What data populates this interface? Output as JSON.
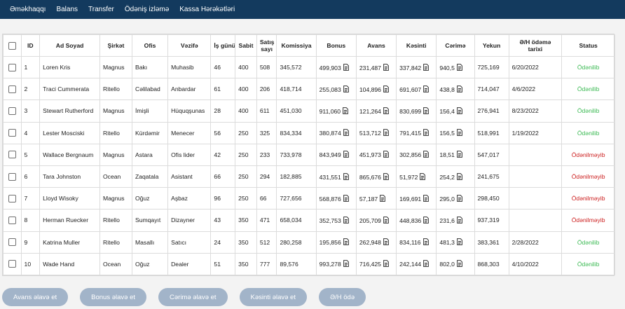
{
  "nav": {
    "items": [
      "Əməkhaqqı",
      "Balans",
      "Transfer",
      "Ödəniş izləmə",
      "Kassa Hərəkətləri"
    ]
  },
  "table": {
    "headers": {
      "id": "ID",
      "name": "Ad Soyad",
      "company": "Şirkət",
      "office": "Ofis",
      "position": "Vəzifə",
      "workdays": "İş günü",
      "base": "Sabit",
      "sales": "Satış sayı",
      "commission": "Komissiya",
      "bonus": "Bonus",
      "advance": "Avans",
      "deduction": "Kəsinti",
      "fine": "Cərimə",
      "total": "Yekun",
      "pay_date": "Ə/H ödəmə tarixi",
      "status": "Status"
    },
    "rows": [
      {
        "id": "1",
        "name": "Loren Kris",
        "company": "Magnus",
        "office": "Bakı",
        "position": "Muhasib",
        "workdays": "46",
        "base": "400",
        "sales": "508",
        "commission": "345,572",
        "bonus": "499,903",
        "advance": "231,487",
        "deduction": "337,842",
        "fine": "940,5",
        "total": "725,169",
        "pay_date": "6/20/2022",
        "status": "Ödənilib",
        "paid": true
      },
      {
        "id": "2",
        "name": "Traci Cummerata",
        "company": "Ritello",
        "office": "Cəlilabad",
        "position": "Anbardar",
        "workdays": "61",
        "base": "400",
        "sales": "206",
        "commission": "418,714",
        "bonus": "255,083",
        "advance": "104,896",
        "deduction": "691,607",
        "fine": "438,8",
        "total": "714,047",
        "pay_date": "4/6/2022",
        "status": "Ödənilib",
        "paid": true
      },
      {
        "id": "3",
        "name": "Stewart Rutherford",
        "company": "Magnus",
        "office": "İmişli",
        "position": "Hüquqşunas",
        "workdays": "28",
        "base": "400",
        "sales": "611",
        "commission": "451,030",
        "bonus": "911,060",
        "advance": "121,264",
        "deduction": "830,699",
        "fine": "156,4",
        "total": "276,941",
        "pay_date": "8/23/2022",
        "status": "Ödənilib",
        "paid": true
      },
      {
        "id": "4",
        "name": "Lester Mosciski",
        "company": "Ritello",
        "office": "Kürdəmir",
        "position": "Menecer",
        "workdays": "56",
        "base": "250",
        "sales": "325",
        "commission": "834,334",
        "bonus": "380,874",
        "advance": "513,712",
        "deduction": "791,415",
        "fine": "156,5",
        "total": "518,991",
        "pay_date": "1/19/2022",
        "status": "Ödənilib",
        "paid": true
      },
      {
        "id": "5",
        "name": "Wallace Bergnaum",
        "company": "Magnus",
        "office": "Astara",
        "position": "Ofis lider",
        "workdays": "42",
        "base": "250",
        "sales": "233",
        "commission": "733,978",
        "bonus": "843,949",
        "advance": "451,973",
        "deduction": "302,856",
        "fine": "18,51",
        "total": "547,017",
        "pay_date": "",
        "status": "Ödənilməyib",
        "paid": false
      },
      {
        "id": "6",
        "name": "Tara Johnston",
        "company": "Ocean",
        "office": "Zaqatala",
        "position": "Asistant",
        "workdays": "66",
        "base": "250",
        "sales": "294",
        "commission": "182,885",
        "bonus": "431,551",
        "advance": "865,676",
        "deduction": "51,972",
        "fine": "254,2",
        "total": "241,675",
        "pay_date": "",
        "status": "Ödənilməyib",
        "paid": false
      },
      {
        "id": "7",
        "name": "Lloyd Wisoky",
        "company": "Magnus",
        "office": "Oğuz",
        "position": "Aşbaz",
        "workdays": "96",
        "base": "250",
        "sales": "66",
        "commission": "727,656",
        "bonus": "568,876",
        "advance": "57,187",
        "deduction": "169,691",
        "fine": "295,0",
        "total": "298,450",
        "pay_date": "",
        "status": "Ödənilməyib",
        "paid": false
      },
      {
        "id": "8",
        "name": "Herman Ruecker",
        "company": "Ritello",
        "office": "Sumqayıt",
        "position": "Dizayner",
        "workdays": "43",
        "base": "350",
        "sales": "471",
        "commission": "658,034",
        "bonus": "352,753",
        "advance": "205,709",
        "deduction": "448,836",
        "fine": "231,6",
        "total": "937,319",
        "pay_date": "",
        "status": "Ödənilməyib",
        "paid": false
      },
      {
        "id": "9",
        "name": "Katrina Muller",
        "company": "Ritello",
        "office": "Masallı",
        "position": "Satıcı",
        "workdays": "24",
        "base": "350",
        "sales": "512",
        "commission": "280,258",
        "bonus": "195,856",
        "advance": "262,948",
        "deduction": "834,116",
        "fine": "481,3",
        "total": "383,361",
        "pay_date": "2/28/2022",
        "status": "Ödənilib",
        "paid": true
      },
      {
        "id": "10",
        "name": "Wade Hand",
        "company": "Ocean",
        "office": "Oğuz",
        "position": "Dealer",
        "workdays": "51",
        "base": "350",
        "sales": "777",
        "commission": "89,576",
        "bonus": "993,278",
        "advance": "716,425",
        "deduction": "242,144",
        "fine": "802,0",
        "total": "868,303",
        "pay_date": "4/10/2022",
        "status": "Ödənilib",
        "paid": true
      }
    ]
  },
  "actions": {
    "add_advance": "Avans əlavə et",
    "add_bonus": "Bonus əlavə et",
    "add_fine": "Cərimə əlavə et",
    "add_deduction": "Kəsinti əlavə et",
    "pay_salary": "Ə/H ödə"
  },
  "colors": {
    "navbar": "#133a5e",
    "paid": "#3cba54",
    "unpaid": "#cc1f1f",
    "button": "#a2b4c9"
  },
  "icons": {
    "row_value_icon": "document-icon"
  }
}
